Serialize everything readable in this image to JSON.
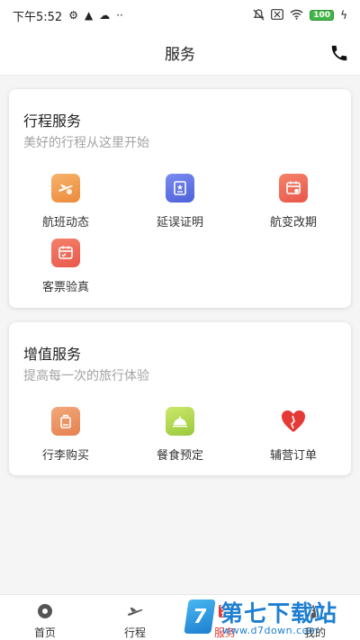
{
  "status_bar": {
    "time": "下午5:52",
    "battery": "100"
  },
  "header": {
    "title": "服务",
    "phone_icon": "phone-icon"
  },
  "itinerary_card": {
    "title": "行程服务",
    "subtitle": "美好的行程从这里开始",
    "items": [
      {
        "label": "航班动态",
        "icon": "flight-status-icon",
        "color": "#ee8a3b"
      },
      {
        "label": "延误证明",
        "icon": "delay-certificate-icon",
        "color": "#4c61d8"
      },
      {
        "label": "航变改期",
        "icon": "reschedule-icon",
        "color": "#e9574a"
      },
      {
        "label": "客票验真",
        "icon": "ticket-verify-icon",
        "color": "#e9574a"
      }
    ]
  },
  "value_card": {
    "title": "增值服务",
    "subtitle": "提高每一次的旅行体验",
    "items": [
      {
        "label": "行李购买",
        "icon": "luggage-icon",
        "color": "#e5814f"
      },
      {
        "label": "餐食预定",
        "icon": "meal-icon",
        "color": "#98c93b"
      },
      {
        "label": "辅营订单",
        "icon": "heart-icon",
        "color": "#e53935"
      }
    ]
  },
  "tabbar": {
    "tabs": [
      {
        "label": "首页",
        "icon": "home-icon"
      },
      {
        "label": "行程",
        "icon": "plane-icon"
      },
      {
        "label": "服务",
        "icon": "service-icon",
        "active": true
      },
      {
        "label": "我的",
        "icon": "profile-icon"
      }
    ]
  },
  "watermark": {
    "logo": "7",
    "text": "第七下载站",
    "url": "www.d7down.com"
  },
  "colors": {
    "accent": "#e53935",
    "background": "#f5f5f5",
    "card": "#ffffff"
  }
}
